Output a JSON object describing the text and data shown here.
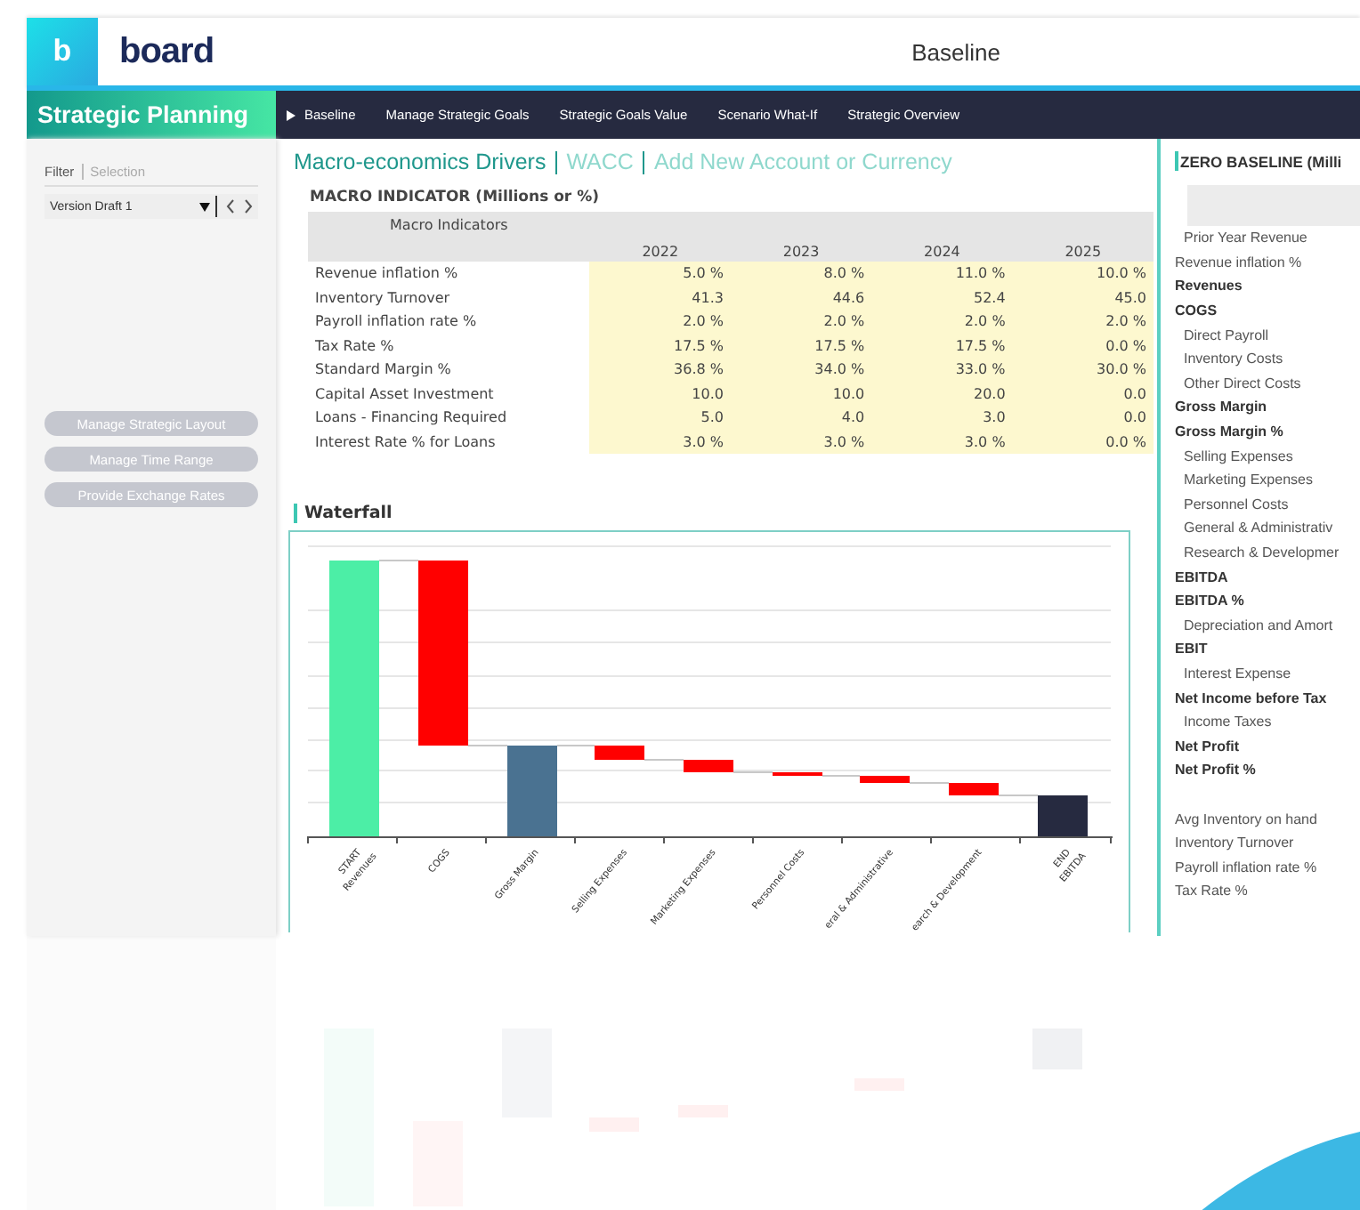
{
  "header": {
    "logo_mark": "b",
    "brand": "board",
    "title": "Baseline"
  },
  "app_name": "Strategic Planning",
  "nav": [
    {
      "label": "Baseline",
      "selected": true
    },
    {
      "label": "Manage Strategic Goals",
      "selected": false
    },
    {
      "label": "Strategic Goals Value",
      "selected": false
    },
    {
      "label": "Scenario What-If",
      "selected": false
    },
    {
      "label": "Strategic Overview",
      "selected": false
    }
  ],
  "sidebar": {
    "tabs": [
      {
        "label": "Filter",
        "selected": true
      },
      {
        "label": "Selection",
        "selected": false
      }
    ],
    "version_select": {
      "value": "Version Draft 1"
    },
    "buttons": [
      "Manage Strategic Layout",
      "Manage Time Range",
      "Provide Exchange Rates"
    ]
  },
  "page_links": [
    {
      "label": "Macro-economics Drivers",
      "selected": true
    },
    {
      "label": "WACC",
      "selected": false
    },
    {
      "label": "Add New Account or Currency",
      "selected": false
    }
  ],
  "macro_table": {
    "title": "MACRO INDICATOR (Millions or %)",
    "corner": "Macro Indicators",
    "columns": [
      "2022",
      "2023",
      "2024",
      "2025"
    ],
    "rows": [
      {
        "label": "Revenue inflation %",
        "values": [
          "5.0 %",
          "8.0 %",
          "11.0 %",
          "10.0 %"
        ]
      },
      {
        "label": "Inventory Turnover",
        "values": [
          "41.3",
          "44.6",
          "52.4",
          "45.0"
        ]
      },
      {
        "label": "Payroll inflation rate %",
        "values": [
          "2.0 %",
          "2.0 %",
          "2.0 %",
          "2.0 %"
        ]
      },
      {
        "label": "Tax Rate %",
        "values": [
          "17.5 %",
          "17.5 %",
          "17.5 %",
          "0.0 %"
        ]
      },
      {
        "label": "Standard Margin %",
        "values": [
          "36.8 %",
          "34.0 %",
          "33.0 %",
          "30.0 %"
        ]
      },
      {
        "label": "Capital Asset Investment",
        "values": [
          "10.0",
          "10.0",
          "20.0",
          "0.0"
        ]
      },
      {
        "label": "Loans - Financing Required",
        "values": [
          "5.0",
          "4.0",
          "3.0",
          "0.0"
        ]
      },
      {
        "label": "Interest Rate % for Loans",
        "values": [
          "3.0 %",
          "3.0 %",
          "3.0 %",
          "0.0 %"
        ]
      }
    ]
  },
  "waterfall": {
    "title": "Waterfall",
    "labels": [
      [
        "START",
        "Revenues"
      ],
      [
        "COGS"
      ],
      [
        "Gross Margin"
      ],
      [
        "Selling Expenses"
      ],
      [
        "Marketing Expenses"
      ],
      [
        "Personnel Costs"
      ],
      [
        "eral & Administrative"
      ],
      [
        "earch & Development"
      ],
      [
        "END",
        "EBITDA"
      ]
    ]
  },
  "zero_baseline": {
    "title": "ZERO BASELINE (Milli",
    "rows": [
      {
        "label": "Prior Year Revenue",
        "kind": "sub"
      },
      {
        "label": "Revenue inflation %",
        "kind": "plain"
      },
      {
        "label": "Revenues",
        "kind": "total"
      },
      {
        "label": "COGS",
        "kind": "total"
      },
      {
        "label": "Direct Payroll",
        "kind": "sub"
      },
      {
        "label": "Inventory Costs",
        "kind": "sub"
      },
      {
        "label": "Other Direct Costs",
        "kind": "sub"
      },
      {
        "label": "Gross Margin",
        "kind": "total"
      },
      {
        "label": "Gross Margin %",
        "kind": "total"
      },
      {
        "label": "Selling Expenses",
        "kind": "sub"
      },
      {
        "label": "Marketing Expenses",
        "kind": "sub"
      },
      {
        "label": "Personnel Costs",
        "kind": "sub"
      },
      {
        "label": "General & Administrativ",
        "kind": "sub"
      },
      {
        "label": "Research & Developmer",
        "kind": "sub"
      },
      {
        "label": "EBITDA",
        "kind": "total"
      },
      {
        "label": "EBITDA %",
        "kind": "total"
      },
      {
        "label": "Depreciation and Amort",
        "kind": "sub"
      },
      {
        "label": "EBIT",
        "kind": "total"
      },
      {
        "label": "Interest Expense",
        "kind": "sub"
      },
      {
        "label": "Net Income before Tax",
        "kind": "total"
      },
      {
        "label": "Income Taxes",
        "kind": "sub"
      },
      {
        "label": "Net Profit",
        "kind": "total"
      },
      {
        "label": "Net Profit %",
        "kind": "total"
      }
    ],
    "kpi_rows": [
      {
        "label": "Avg Inventory on hand",
        "kind": "plain"
      },
      {
        "label": "Inventory Turnover",
        "kind": "plain"
      },
      {
        "label": "Payroll inflation rate %",
        "kind": "plain"
      },
      {
        "label": "Tax Rate %",
        "kind": "plain"
      }
    ]
  }
}
